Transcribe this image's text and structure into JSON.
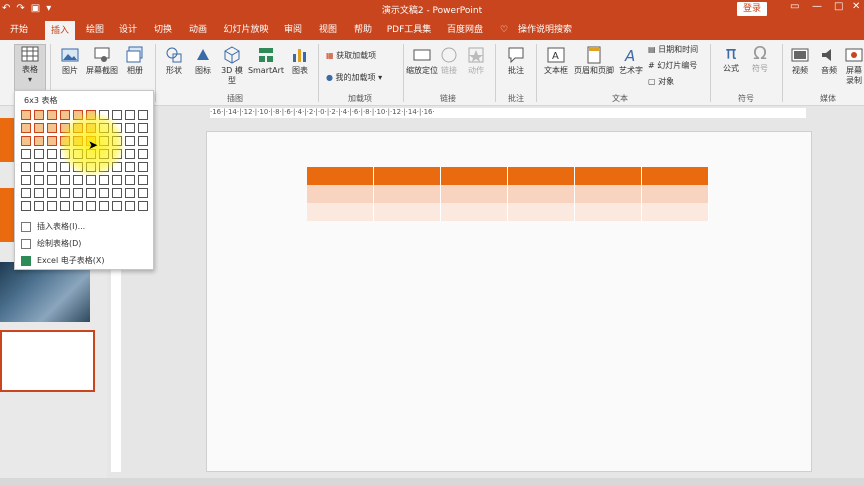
{
  "window": {
    "title": "演示文稿2 - PowerPoint",
    "login_label": "登录"
  },
  "quick_access": [
    "↶",
    "↷",
    "▣",
    "▾"
  ],
  "tabs": [
    {
      "label": "开始"
    },
    {
      "label": "插入"
    },
    {
      "label": "绘图"
    },
    {
      "label": "设计"
    },
    {
      "label": "切换"
    },
    {
      "label": "动画"
    },
    {
      "label": "幻灯片放映"
    },
    {
      "label": "审阅"
    },
    {
      "label": "视图"
    },
    {
      "label": "帮助"
    },
    {
      "label": "PDF工具集"
    },
    {
      "label": "百度网盘"
    },
    {
      "label": "操作说明搜索"
    }
  ],
  "ribbon": {
    "table": "表格",
    "picture": "图片",
    "screenshot": "屏幕截图",
    "album": "相册",
    "shapes": "形状",
    "icons": "图标",
    "model3d": "3D 模型",
    "smartart": "SmartArt",
    "chart": "图表",
    "get_addins": "获取加载项",
    "my_addins": "我的加载项",
    "zoom": "缩放定位",
    "link": "链接",
    "action": "动作",
    "comment": "批注",
    "textbox": "文本框",
    "header_footer": "页眉和页脚",
    "wordart": "艺术字",
    "datetime": "日期和时间",
    "slide_number": "幻灯片编号",
    "object": "对象",
    "equation": "公式",
    "symbol": "符号",
    "video": "视频",
    "audio": "音频",
    "screen_record": "屏幕录制",
    "groups": {
      "illustrations": "插图",
      "addins": "加载项",
      "links": "链接",
      "comments": "批注",
      "text": "文本",
      "symbols": "符号",
      "media": "媒体"
    }
  },
  "dropdown": {
    "header": "6x3 表格",
    "insert_table": "插入表格(I)...",
    "draw_table": "绘制表格(D)",
    "excel_table": "Excel 电子表格(X)",
    "selected_cols": 6,
    "selected_rows": 3
  },
  "ruler": "·16·|·14·|·12·|·10·|·8·|·6·|·4·|·2·|·0·|·2·|·4·|·6·|·8·|·10·|·12·|·14·|·16·",
  "colors": {
    "accent": "#c8451d",
    "table_header": "#e96a0f",
    "table_row1": "#f8d3c0",
    "table_row2": "#fbe8de"
  }
}
